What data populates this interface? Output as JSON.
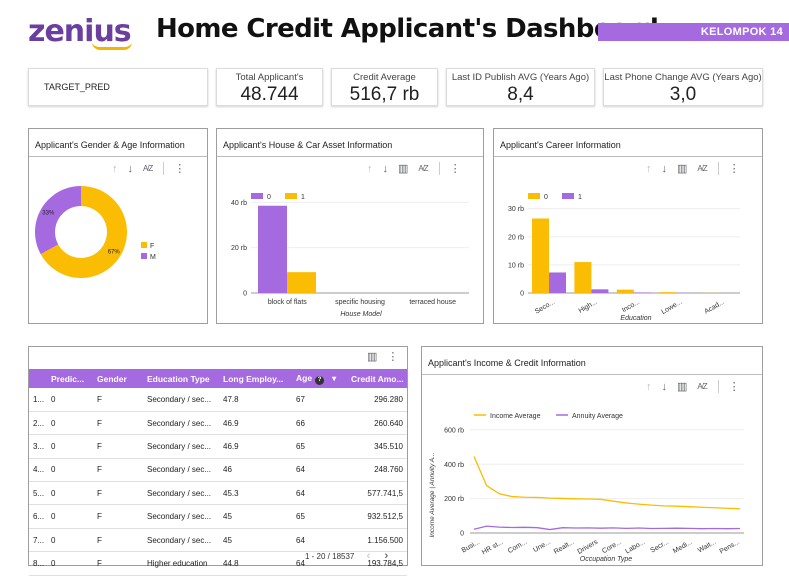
{
  "header": {
    "logo_text": "zenius",
    "title": "Home Credit Applicant's Dashboard",
    "group_label": "KELOMPOK 14",
    "brand_color": "#6b3fa0",
    "accent_color": "#a56ae0"
  },
  "filter": {
    "label": "TARGET_PRED",
    "icon": "caret-down-icon"
  },
  "kpis": [
    {
      "label": "Total Applicant's",
      "value": "48.744"
    },
    {
      "label": "Credit Average",
      "value": "516,7 rb"
    },
    {
      "label": "Last ID Publish AVG (Years Ago)",
      "value": "8,4"
    },
    {
      "label": "Last Phone Change AVG (Years Ago)",
      "value": "3,0"
    }
  ],
  "toolbar_icons": [
    "sort-up-icon",
    "sort-down-icon",
    "drill-icon",
    "sort-az-icon",
    "more-vert-icon"
  ],
  "panels": {
    "gender": {
      "title": "Applicant's Gender & Age Information"
    },
    "house": {
      "title": "Applicant's House & Car Asset Information"
    },
    "career": {
      "title": "Applicant's Career Information"
    },
    "income": {
      "title": "Applicant's Income & Credit Information"
    }
  },
  "chart_data": [
    {
      "type": "pie",
      "title": "Applicant's Gender & Age Information",
      "labels": [
        "F",
        "M"
      ],
      "values": [
        67,
        33
      ],
      "data_labels": [
        "67%",
        "33%"
      ],
      "colors": [
        "#fbbc04",
        "#a56ae0"
      ],
      "legend": "right"
    },
    {
      "type": "bar",
      "title": "Applicant's House & Car Asset Information",
      "categories": [
        "block of flats",
        "specific housing",
        "terraced house"
      ],
      "series": [
        {
          "name": "0",
          "values": [
            38500,
            0,
            0
          ],
          "color": "#a56ae0"
        },
        {
          "name": "1",
          "values": [
            9200,
            0,
            0
          ],
          "color": "#fbbc04"
        }
      ],
      "xlabel": "House Model",
      "ylabel": "",
      "ylim": [
        0,
        45000
      ],
      "yticks": [
        "0",
        "20 rb",
        "40 rb"
      ],
      "legend": "top-left"
    },
    {
      "type": "bar",
      "title": "Applicant's Career Information",
      "categories": [
        "Seco...",
        "High...",
        "Inco...",
        "Lowe...",
        "Acad..."
      ],
      "series": [
        {
          "name": "0",
          "values": [
            26500,
            11000,
            1200,
            300,
            50
          ],
          "color": "#fbbc04"
        },
        {
          "name": "1",
          "values": [
            7300,
            1300,
            200,
            50,
            0
          ],
          "color": "#a56ae0"
        }
      ],
      "xlabel": "Education",
      "ylabel": "",
      "ylim": [
        0,
        32000
      ],
      "yticks": [
        "0",
        "10 rb",
        "20 rb",
        "30 rb"
      ],
      "legend": "top-left"
    },
    {
      "type": "line",
      "title": "Applicant's Income & Credit Information",
      "categories": [
        "Busi...",
        "HR st...",
        "Com...",
        "Une...",
        "Realt...",
        "Drivers",
        "Core...",
        "Labo...",
        "Secr...",
        "Medi...",
        "Wait...",
        "Pens..."
      ],
      "series": [
        {
          "name": "Income Average",
          "color": "#fbbc04",
          "values": [
            445000,
            275000,
            228000,
            212000,
            208000,
            207000,
            203000,
            201000,
            199000,
            198000,
            196000,
            185000,
            175000,
            168000,
            162000,
            158000,
            156000,
            153000,
            150000,
            147000,
            144000,
            141000
          ]
        },
        {
          "name": "Annuity Average",
          "color": "#a56ae0",
          "values": [
            22000,
            40000,
            34000,
            32000,
            33000,
            31000,
            20000,
            31000,
            29000,
            30000,
            28000,
            30000,
            27000,
            29000,
            26000,
            27000,
            28000,
            27000,
            25000,
            26000,
            25000,
            26000
          ]
        }
      ],
      "xlabel": "Occupation Type",
      "ylabel": "Income Average | Annuity A...",
      "ylim": [
        0,
        640000
      ],
      "yticks": [
        "0",
        "200 rb",
        "400 rb",
        "600 rb"
      ],
      "legend": "top-left"
    }
  ],
  "table": {
    "columns": [
      "",
      "Predic...",
      "Gender",
      "Education Type",
      "Long Employ...",
      "Age",
      "Credit Amo..."
    ],
    "rows": [
      [
        "1...",
        "0",
        "F",
        "Secondary / sec...",
        "47.8",
        "67",
        "296.280"
      ],
      [
        "2...",
        "0",
        "F",
        "Secondary / sec...",
        "46.9",
        "66",
        "260.640"
      ],
      [
        "3...",
        "0",
        "F",
        "Secondary / sec...",
        "46.9",
        "65",
        "345.510"
      ],
      [
        "4...",
        "0",
        "F",
        "Secondary / sec...",
        "46",
        "64",
        "248.760"
      ],
      [
        "5...",
        "0",
        "F",
        "Secondary / sec...",
        "45.3",
        "64",
        "577.741,5"
      ],
      [
        "6...",
        "0",
        "F",
        "Secondary / sec...",
        "45",
        "65",
        "932.512,5"
      ],
      [
        "7...",
        "0",
        "F",
        "Secondary / sec...",
        "45",
        "64",
        "1.156.500"
      ],
      [
        "8...",
        "0",
        "F",
        "Higher education",
        "44.8",
        "64",
        "193.784,5"
      ]
    ],
    "pagination": "1 - 20 / 18537",
    "prev_icon": "chevron-left-icon",
    "next_icon": "chevron-right-icon"
  }
}
